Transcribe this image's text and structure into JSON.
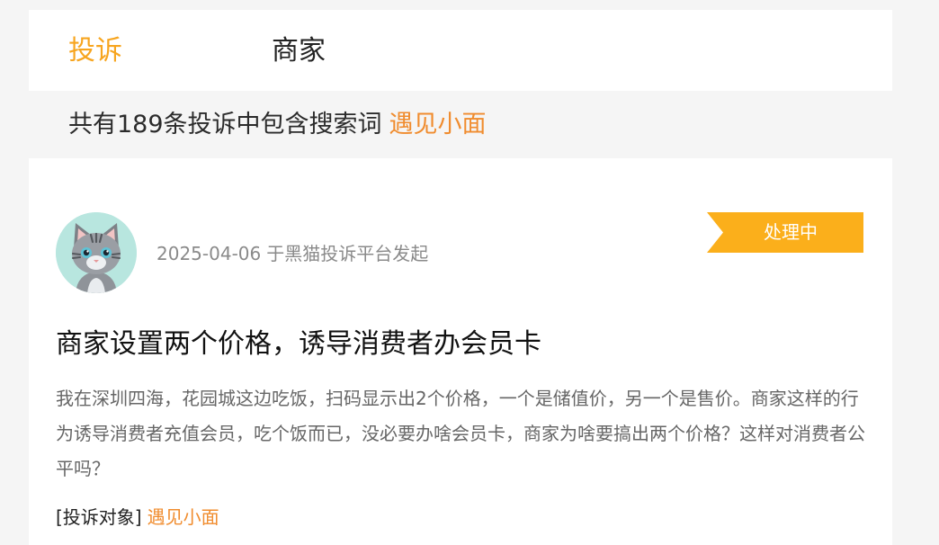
{
  "tabs": [
    {
      "label": "投诉",
      "active": true
    },
    {
      "label": "商家",
      "active": false
    }
  ],
  "search_summary": {
    "text": "共有189条投诉中包含搜索词",
    "keyword": "遇见小面"
  },
  "complaint": {
    "date": "2025-04-06",
    "source": "于黑猫投诉平台发起",
    "status": "处理中",
    "title": "商家设置两个价格，诱导消费者办会员卡",
    "body": "我在深圳四海，花园城这边吃饭，扫码显示出2个价格，一个是储值价，另一个是售价。商家这样的行为诱导消费者充值会员，吃个饭而已，没必要办啥会员卡，商家为啥要搞出两个价格？这样对消费者公平吗？",
    "target_label": "[投诉对象]",
    "target_value": "遇见小面"
  },
  "colors": {
    "accent": "#f7a51f",
    "keyword": "#f08c2e",
    "status_badge": "#fbaf1b",
    "avatar_bg": "#b8e6df"
  },
  "icons": {
    "avatar": "gray-cat-avatar"
  }
}
